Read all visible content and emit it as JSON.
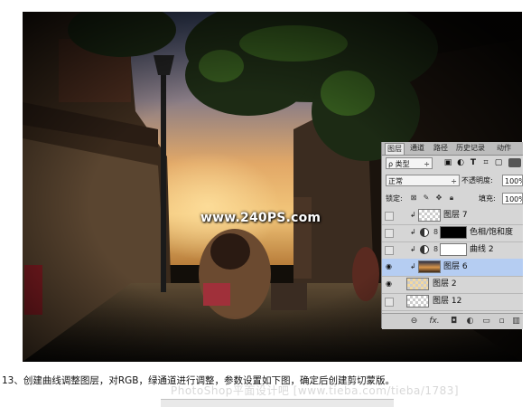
{
  "photo": {
    "watermark": "www.240PS.com"
  },
  "layers_panel": {
    "tabs": [
      "图层",
      "通道",
      "路径",
      "历史记录",
      "动作"
    ],
    "active_tab": "图层",
    "filter": {
      "kind_label": "ρ 类型",
      "kind_arrow": "÷",
      "icons": [
        "image-filter-icon",
        "adjustment-filter-icon",
        "type-filter-icon",
        "shape-filter-icon",
        "smart-object-filter-icon"
      ]
    },
    "blend_mode": "正常",
    "blend_arrow": "÷",
    "opacity_label": "不透明度:",
    "opacity_value": "100%",
    "lock_label": "锁定:",
    "fill_label": "填充:",
    "fill_value": "100%",
    "layers": [
      {
        "name": "图层 7",
        "visible": false,
        "clipped": true,
        "type": "pixel",
        "selected": false
      },
      {
        "name": "色相/饱和度",
        "visible": false,
        "clipped": true,
        "type": "adjustment",
        "mask": "black",
        "selected": false
      },
      {
        "name": "曲线 2",
        "visible": false,
        "clipped": true,
        "type": "adjustment",
        "mask": "white",
        "selected": false
      },
      {
        "name": "图层 6",
        "visible": true,
        "clipped": true,
        "type": "pixel",
        "selected": true
      },
      {
        "name": "图层 2",
        "visible": true,
        "clipped": false,
        "type": "pixel",
        "selected": false
      },
      {
        "name": "图层 12",
        "visible": false,
        "clipped": false,
        "type": "pixel",
        "selected": false
      }
    ],
    "footer_icons": [
      "link-layers-icon",
      "fx-icon",
      "add-mask-icon",
      "new-adjustment-icon",
      "new-group-icon",
      "new-layer-icon",
      "delete-layer-icon"
    ],
    "footer_labels": [
      "⊖",
      "fx."
    ]
  },
  "caption": "13、创建曲线调整图层，对RGB，绿通道进行调整，参数设置如下图，确定后创建剪切蒙版。",
  "site_watermark": "PhotoShop平面设计吧 [www.tieba.com/tieba/1783]"
}
